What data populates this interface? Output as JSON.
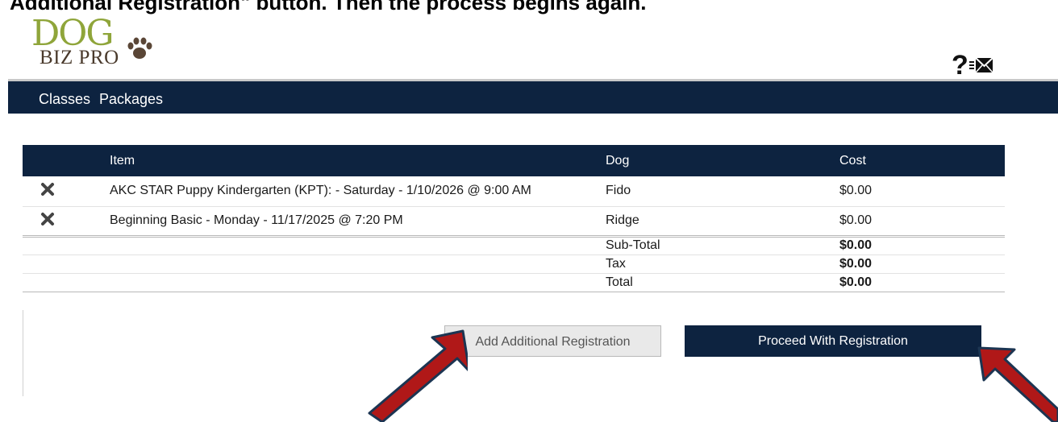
{
  "caption": "Additional Registration\" button.  Then the process begins again.",
  "logo": {
    "line1": "DOG",
    "line2": "BIZ PRO"
  },
  "header_icons": {
    "help": "?",
    "mail": "envelope-icon"
  },
  "nav": {
    "items": [
      {
        "label": "Classes"
      },
      {
        "label": "Packages"
      }
    ]
  },
  "cart": {
    "headers": {
      "item": "Item",
      "dog": "Dog",
      "cost": "Cost"
    },
    "rows": [
      {
        "item": "AKC STAR Puppy Kindergarten (KPT): - Saturday - 1/10/2026 @ 9:00 AM",
        "dog": "Fido",
        "cost": "$0.00"
      },
      {
        "item": "Beginning Basic - Monday - 11/17/2025 @ 7:20 PM",
        "dog": "Ridge",
        "cost": "$0.00"
      }
    ],
    "totals": [
      {
        "label": "Sub-Total",
        "value": "$0.00"
      },
      {
        "label": "Tax",
        "value": "$0.00"
      },
      {
        "label": "Total",
        "value": "$0.00"
      }
    ]
  },
  "buttons": {
    "add": "Add Additional Registration",
    "proceed": "Proceed With Registration"
  },
  "colors": {
    "navy": "#0d2340",
    "logo_green": "#8fa53a",
    "arrow_red": "#b01818"
  }
}
